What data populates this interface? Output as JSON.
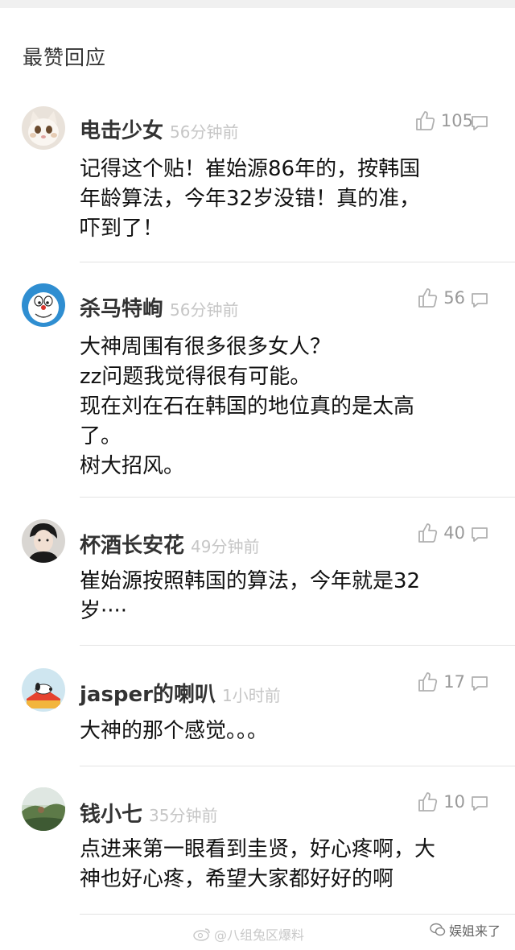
{
  "section": {
    "title": "最赞回应"
  },
  "comments": [
    {
      "username": "电击少女",
      "time": "56分钟前",
      "likes": "105",
      "text": "记得这个贴！崔始源86年的，按韩国\n年龄算法，今年32岁没错！真的准，\n吓到了！",
      "avatar_icon": "cat-avatar"
    },
    {
      "username": "杀马特峋",
      "time": "56分钟前",
      "likes": "56",
      "text": "大神周围有很多很多女人？\nzz问题我觉得很有可能。\n现在刘在石在韩国的地位真的是太高\n了。\n树大招风。",
      "avatar_icon": "doraemon-avatar"
    },
    {
      "username": "杯酒长安花",
      "time": "49分钟前",
      "likes": "40",
      "text": "崔始源按照韩国的算法，今年就是32\n岁····",
      "avatar_icon": "portrait-avatar"
    },
    {
      "username": "jasper的喇叭",
      "time": "1小时前",
      "likes": "17",
      "text": "大神的那个感觉。。。",
      "avatar_icon": "snoopy-avatar"
    },
    {
      "username": "钱小七",
      "time": "35分钟前",
      "likes": "10",
      "text": "点进来第一眼看到圭贤，好心疼啊，大\n神也好心疼，希望大家都好好的啊",
      "avatar_icon": "landscape-avatar"
    }
  ],
  "watermark": {
    "text": "@八组兔区爆料"
  },
  "brand": {
    "text": "娱姐来了"
  }
}
